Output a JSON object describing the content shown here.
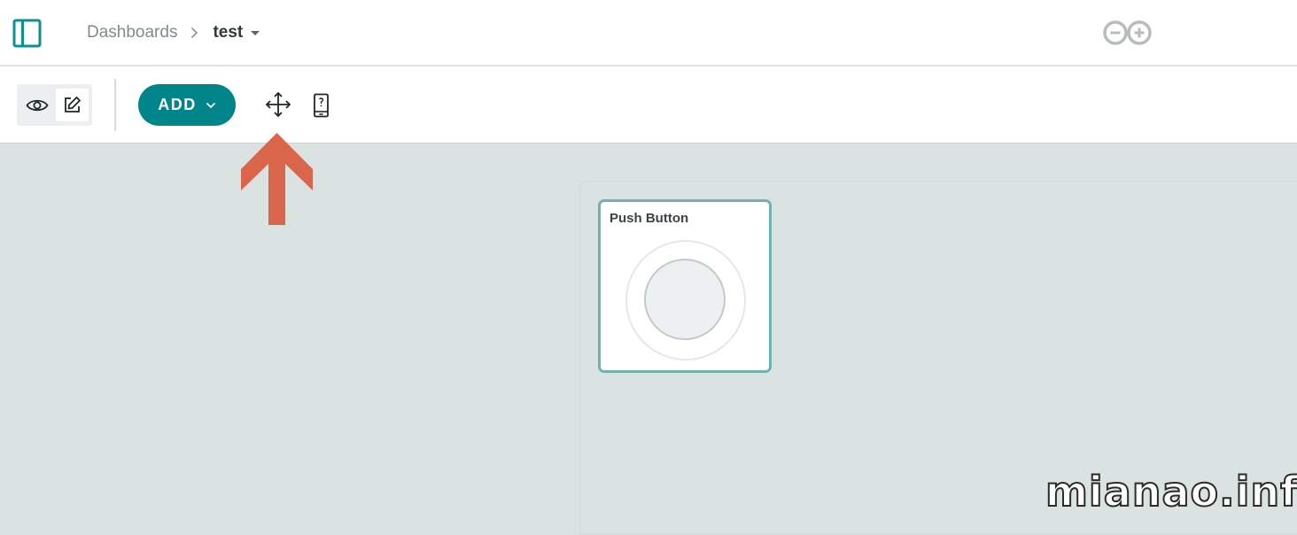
{
  "header": {
    "breadcrumb": {
      "parent": "Dashboards",
      "current": "test"
    },
    "logo": "arduino-logo"
  },
  "toolbar": {
    "add_label": "ADD",
    "icons": {
      "sidebar": "sidebar-toggle-icon",
      "view": "eye-icon",
      "edit": "edit-pencil-icon",
      "move": "move-arrows-icon",
      "mobile": "mobile-phone-icon"
    }
  },
  "widget": {
    "title": "Push Button"
  },
  "watermark": "mianao.info",
  "colors": {
    "accent": "#00868a",
    "widget_border": "#6fb3b0",
    "annotation_arrow": "#d9664b",
    "canvas_bg": "#dae3e2"
  }
}
